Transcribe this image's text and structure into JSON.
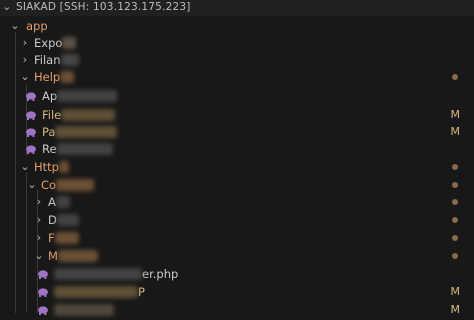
{
  "header": {
    "title": "SIAKAD [SSH: 103.123.175.223]"
  },
  "rows": [
    {
      "label": "app",
      "label_color": "#e3a06b"
    },
    {
      "label": "Expo",
      "blur": "#6b5d4f"
    },
    {
      "label": "Filan",
      "blur": "#4f4f4f"
    },
    {
      "label": "Help",
      "label_color": "#e3a06b",
      "blur": "#7a5a3a"
    },
    {
      "label": "Ap",
      "blur": "#4a4a4a"
    },
    {
      "label": "File",
      "label_color": "#d7ba7d",
      "blur": "#6a5a3c",
      "git": "M"
    },
    {
      "label": "Pa",
      "label_color": "#d7ba7d",
      "blur": "#6a5a3c",
      "git": "M"
    },
    {
      "label": "Re",
      "blur": "#4a4a4a"
    },
    {
      "label": "Http",
      "label_color": "#e3a06b",
      "blur": "#7a5a3a"
    },
    {
      "label": "Co",
      "label_color": "#e3a06b",
      "blur": "#7a5a3a"
    },
    {
      "label": "A",
      "blur": "#4a4a4a"
    },
    {
      "label": "D",
      "blur": "#4a4a4a"
    },
    {
      "label": "F",
      "label_color": "#e3a06b",
      "blur": "#7a5a3a"
    },
    {
      "label": "M",
      "label_color": "#e3a06b",
      "blur": "#7a5a3a"
    },
    {
      "label": "er.php",
      "blur": "#4a4a4a"
    },
    {
      "label": "P",
      "label_color": "#d7ba7d",
      "blur": "#6a5a3c",
      "git": "M"
    },
    {
      "label": "",
      "blur": "#5a5040",
      "git": "M"
    }
  ],
  "colors": {
    "background": "#181818",
    "folder_modified": "#e3a06b",
    "file_modified": "#d7ba7d",
    "php_icon": "#a074c4"
  }
}
